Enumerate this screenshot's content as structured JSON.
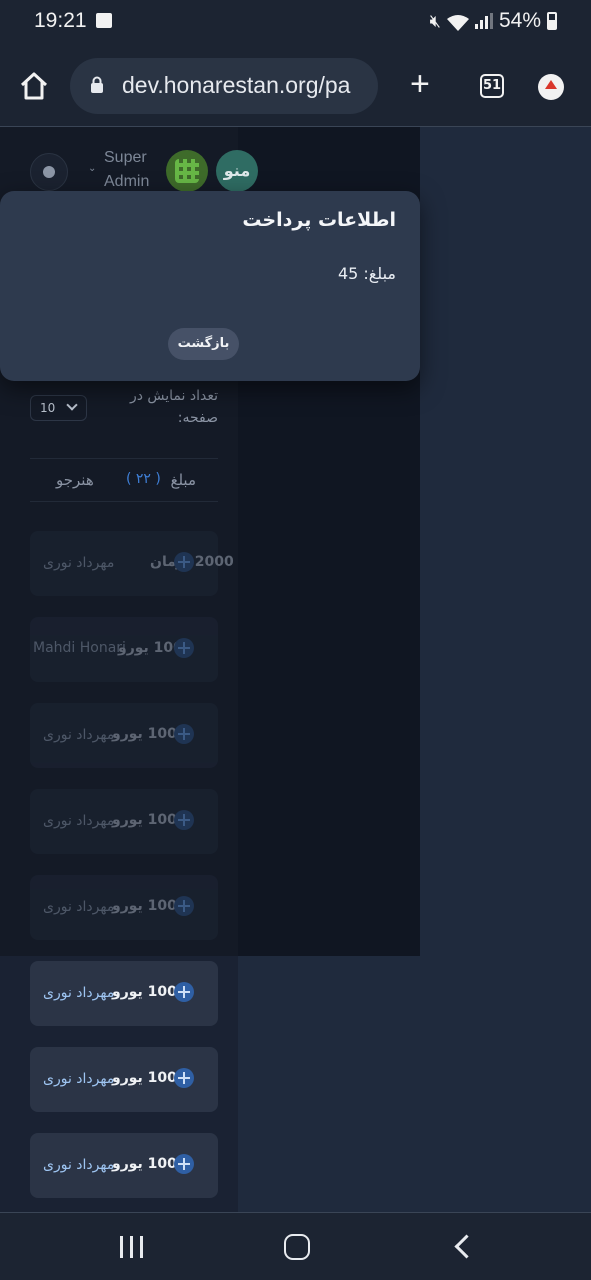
{
  "status_bar": {
    "time": "19:21",
    "battery": "54%"
  },
  "browser": {
    "url": "dev.honarestan.org/pa",
    "tab_count": "51"
  },
  "header": {
    "user_role": "Super Admin",
    "user_role_line1": "Super",
    "user_role_line2": "Admin",
    "avatar_initials": "منو"
  },
  "list": {
    "per_page_label": "تعداد نمایش در صفحه:",
    "per_page_value": "10",
    "col_amount": "مبلغ",
    "col_count": "( ۲۲ )",
    "col_student": "هنرجو",
    "rows": [
      {
        "name": "مهرداد نوری",
        "amount": "2000 تومان"
      },
      {
        "name": "Mahdi Honari",
        "amount": "1000 یورو"
      },
      {
        "name": "مهرداد نوری",
        "amount": "1000 یورو"
      },
      {
        "name": "مهرداد نوری",
        "amount": "1000 یورو"
      },
      {
        "name": "مهرداد نوری",
        "amount": "1000 یورو"
      },
      {
        "name": "مهرداد نوری",
        "amount": "1000 یورو"
      },
      {
        "name": "مهرداد نوری",
        "amount": "1000 یورو"
      },
      {
        "name": "مهرداد نوری",
        "amount": "1000 یورو"
      }
    ]
  },
  "modal": {
    "title": "اطلاعات پرداخت",
    "amount_label": "مبلغ:",
    "amount_value": "45",
    "back_button": "بازگشت"
  },
  "colors": {
    "accent": "#3f7fd6",
    "modal_bg": "#2e3a4e",
    "page_bg": "#1f2a3d"
  }
}
